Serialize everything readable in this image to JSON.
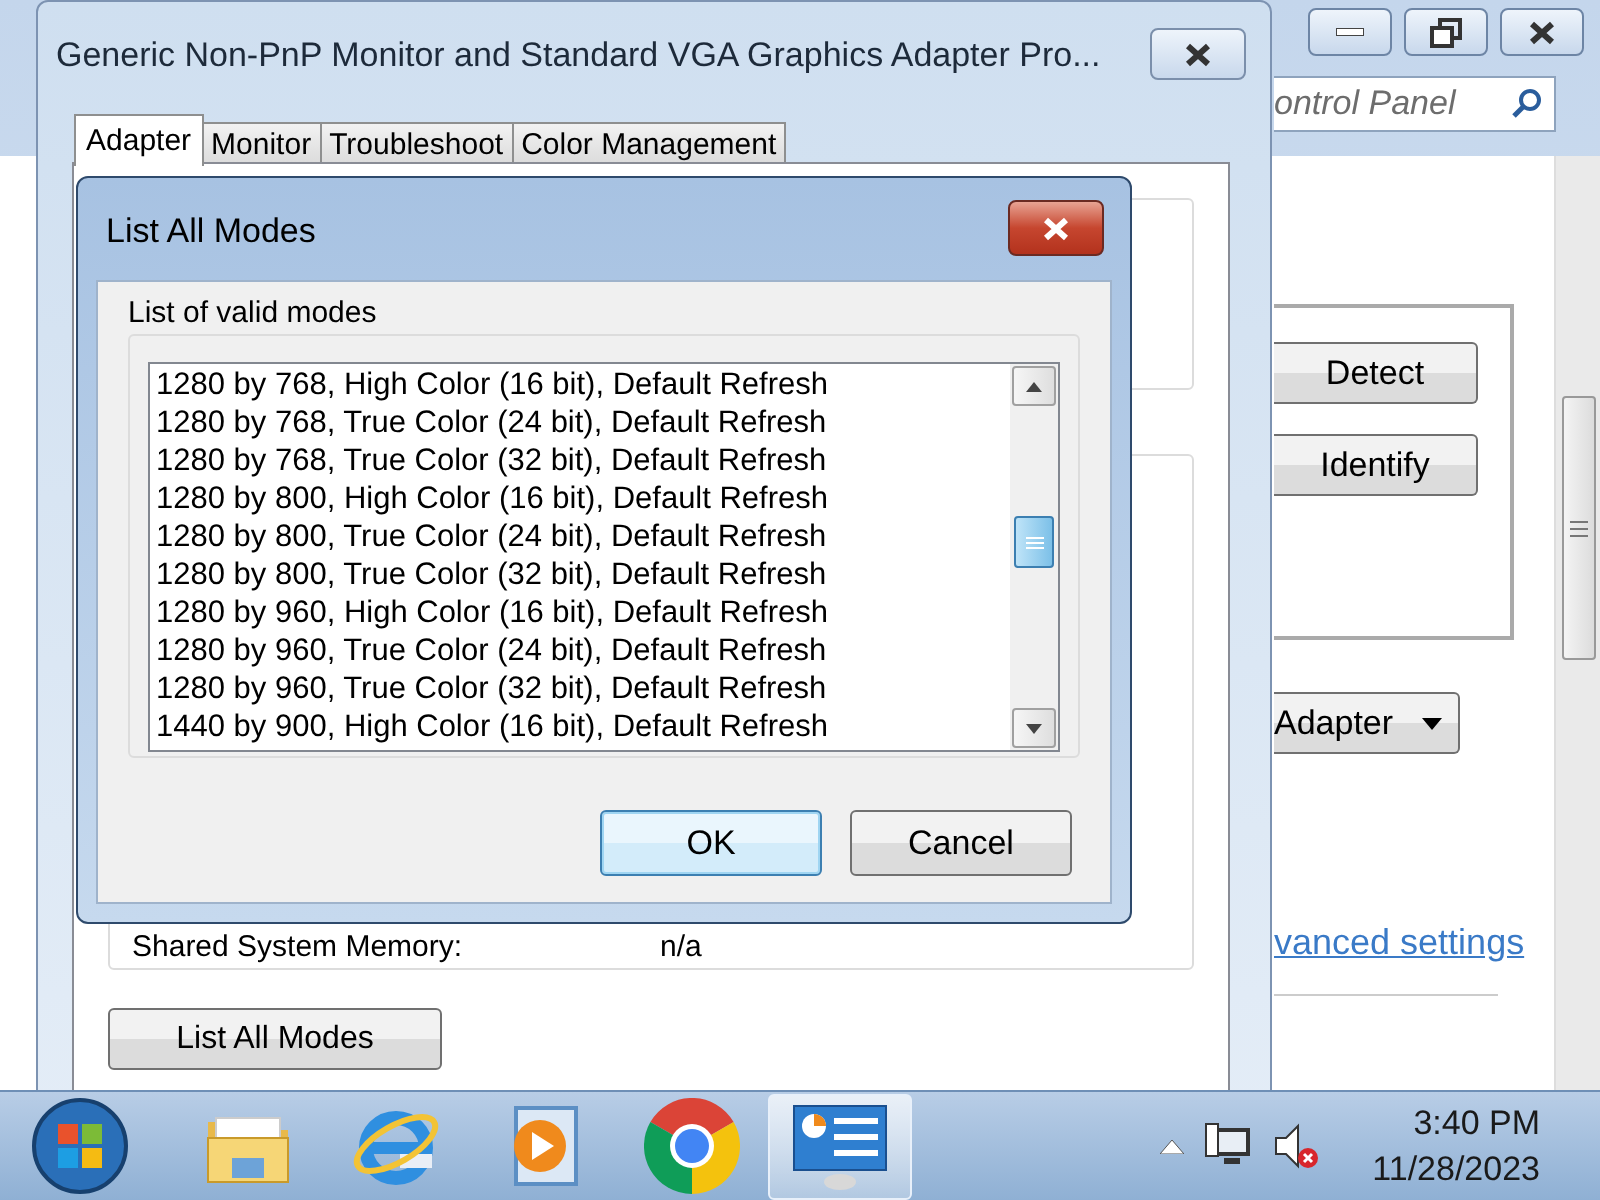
{
  "background_window": {
    "search_field": {
      "placeholder": "ontrol Panel"
    },
    "buttons": [
      "Detect",
      "Identify"
    ],
    "dropdown": {
      "label": "Adapter"
    },
    "link": "vanced settings"
  },
  "properties_window": {
    "title": "Generic Non-PnP Monitor and Standard VGA Graphics Adapter Pro...",
    "tabs": [
      {
        "label": "Adapter",
        "selected": true
      },
      {
        "label": "Monitor",
        "selected": false
      },
      {
        "label": "Troubleshoot",
        "selected": false
      },
      {
        "label": "Color Management",
        "selected": false
      }
    ],
    "info_row": {
      "label": "Shared System Memory:",
      "value": "n/a"
    },
    "button": "List All Modes"
  },
  "dialog": {
    "title": "List All Modes",
    "group_label": "List of valid modes",
    "modes": [
      "1280 by 768, High Color (16 bit), Default Refresh",
      "1280 by 768, True Color (24 bit), Default Refresh",
      "1280 by 768, True Color (32 bit), Default Refresh",
      "1280 by 800, High Color (16 bit), Default Refresh",
      "1280 by 800, True Color (24 bit), Default Refresh",
      "1280 by 800, True Color (32 bit), Default Refresh",
      "1280 by 960, High Color (16 bit), Default Refresh",
      "1280 by 960, True Color (24 bit), Default Refresh",
      "1280 by 960, True Color (32 bit), Default Refresh",
      "1440 by 900, High Color (16 bit), Default Refresh"
    ],
    "buttons": [
      {
        "label": "OK",
        "default": true
      },
      {
        "label": "Cancel",
        "default": false
      }
    ]
  },
  "taskbar": {
    "apps": [
      {
        "kind": "folder",
        "active": false
      },
      {
        "kind": "browser",
        "active": false
      },
      {
        "kind": "player",
        "active": false
      },
      {
        "kind": "chrome",
        "active": false
      },
      {
        "kind": "display",
        "active": true
      }
    ],
    "clock": {
      "time": "3:40 PM",
      "date": "11/28/2023"
    }
  }
}
